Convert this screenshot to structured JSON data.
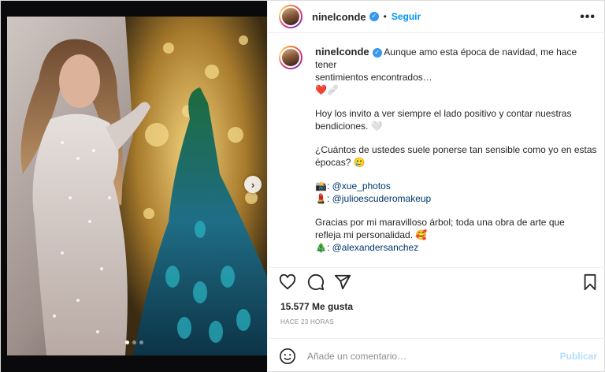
{
  "header": {
    "username": "ninelconde",
    "separator": "•",
    "follow_label": "Seguir",
    "more_label": "•••"
  },
  "caption": {
    "username": "ninelconde",
    "lines": [
      "Aunque amo esta época de navidad, me hace tener",
      "sentimientos encontrados…",
      "❤️🩹"
    ],
    "paragraph2": [
      "Hoy los invito a ver siempre el lado positivo y contar nuestras",
      "bendiciones. 🤍"
    ],
    "paragraph3": [
      "¿Cuántos de ustedes suele ponerse tan sensible como yo en estas",
      "épocas? 🥲"
    ],
    "credits": [
      {
        "emoji": "📸",
        "handle": "@xue_photos"
      },
      {
        "emoji": "💄",
        "handle": "@julioescuderomakeup"
      }
    ],
    "paragraph4": [
      "Gracias por mi maravilloso árbol; toda una obra de arte que",
      "refleja mi personalidad. 🥰"
    ],
    "tree_credit": {
      "emoji": "🎄",
      "handle": "@alexandersanchez"
    }
  },
  "post": {
    "likes": "15.577 Me gusta",
    "time": "Hace 23 horas",
    "carousel_count": 3,
    "carousel_active": 0
  },
  "comment": {
    "placeholder": "Añade un comentario…",
    "publish_label": "Publicar"
  },
  "icons": {
    "like": "heart-icon",
    "comment": "comment-icon",
    "share": "share-icon",
    "save": "bookmark-icon",
    "emoji": "smiley-icon",
    "next": "chevron-right-icon",
    "verified": "verified-badge-icon"
  },
  "colors": {
    "link_blue": "#0095f6",
    "publish_disabled": "#b2dffc",
    "verified": "#3897f0",
    "mention": "#00376b"
  }
}
